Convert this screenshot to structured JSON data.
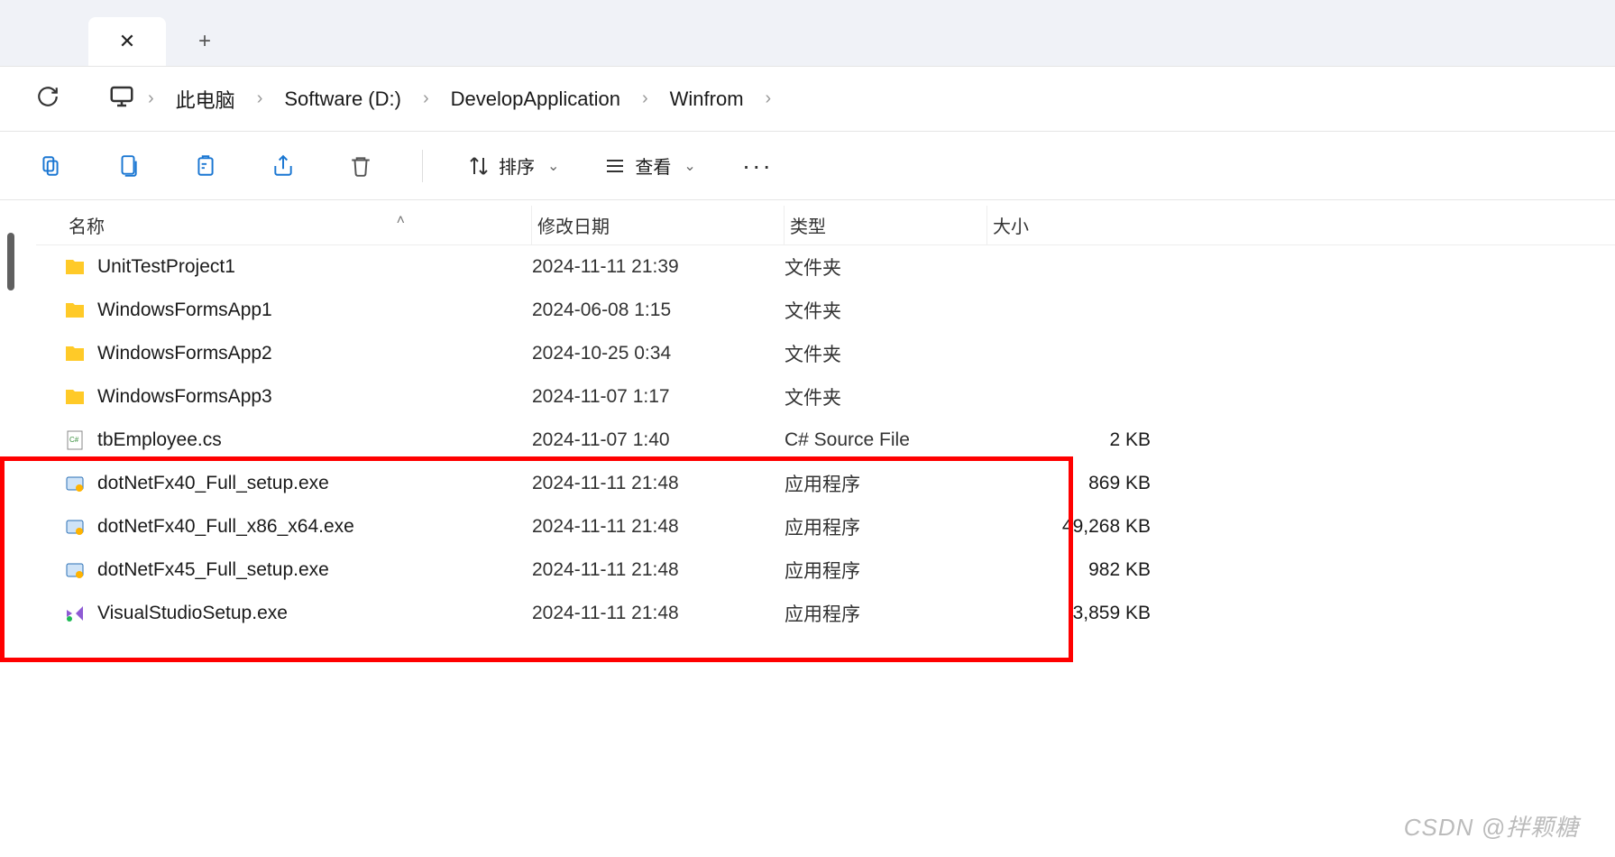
{
  "tabs": {
    "close": "✕",
    "new": "+"
  },
  "breadcrumbs": {
    "items": [
      "此电脑",
      "Software (D:)",
      "DevelopApplication",
      "Winfrom"
    ]
  },
  "toolbar": {
    "sort": "排序",
    "view": "查看"
  },
  "columns": {
    "name": "名称",
    "date": "修改日期",
    "type": "类型",
    "size": "大小"
  },
  "rows": [
    {
      "icon": "folder",
      "name": "UnitTestProject1",
      "date": "2024-11-11 21:39",
      "type": "文件夹",
      "size": ""
    },
    {
      "icon": "folder",
      "name": "WindowsFormsApp1",
      "date": "2024-06-08 1:15",
      "type": "文件夹",
      "size": ""
    },
    {
      "icon": "folder",
      "name": "WindowsFormsApp2",
      "date": "2024-10-25 0:34",
      "type": "文件夹",
      "size": ""
    },
    {
      "icon": "folder",
      "name": "WindowsFormsApp3",
      "date": "2024-11-07 1:17",
      "type": "文件夹",
      "size": ""
    },
    {
      "icon": "cs",
      "name": "tbEmployee.cs",
      "date": "2024-11-07 1:40",
      "type": "C# Source File",
      "size": "2 KB"
    },
    {
      "icon": "exe",
      "name": "dotNetFx40_Full_setup.exe",
      "date": "2024-11-11 21:48",
      "type": "应用程序",
      "size": "869 KB"
    },
    {
      "icon": "exe",
      "name": "dotNetFx40_Full_x86_x64.exe",
      "date": "2024-11-11 21:48",
      "type": "应用程序",
      "size": "49,268 KB"
    },
    {
      "icon": "exe",
      "name": "dotNetFx45_Full_setup.exe",
      "date": "2024-11-11 21:48",
      "type": "应用程序",
      "size": "982 KB"
    },
    {
      "icon": "vs",
      "name": "VisualStudioSetup.exe",
      "date": "2024-11-11 21:48",
      "type": "应用程序",
      "size": "3,859 KB"
    }
  ],
  "highlight": {
    "start": 5,
    "end": 8
  },
  "watermark": "CSDN @拌颗糖"
}
